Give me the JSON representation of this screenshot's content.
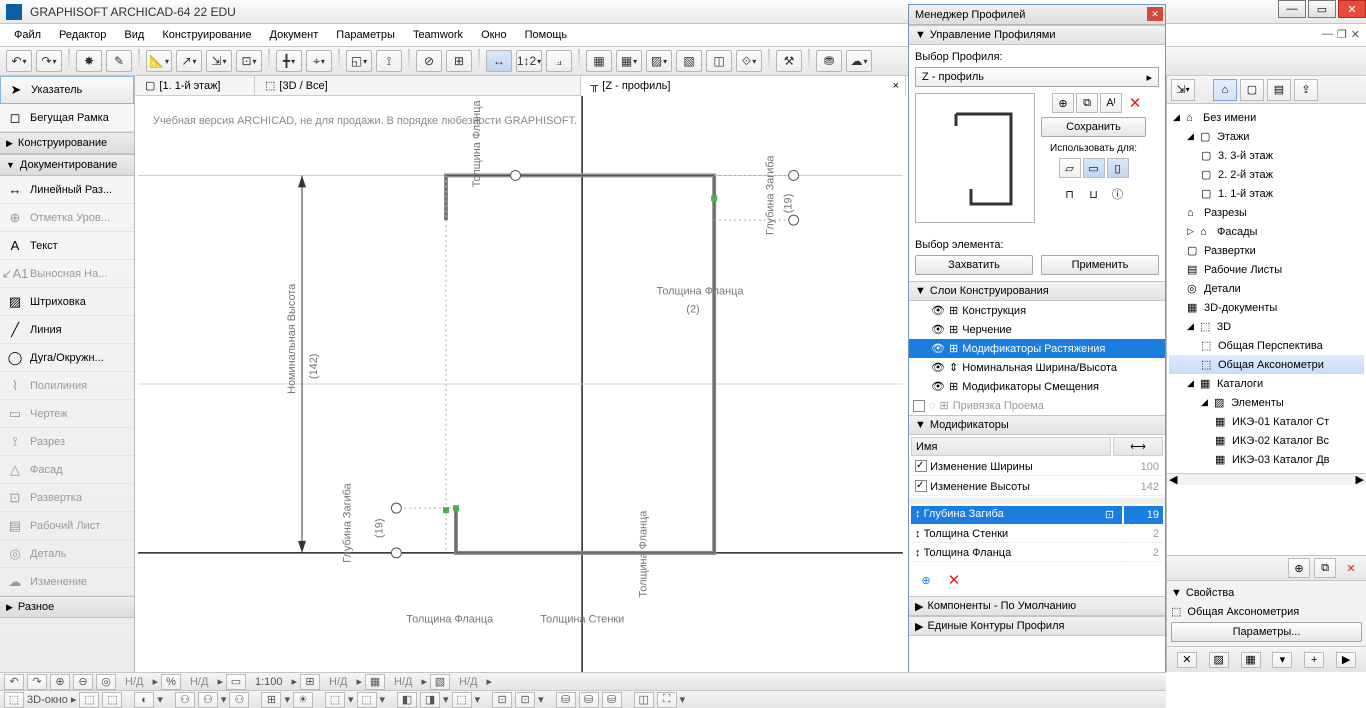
{
  "app": {
    "title": "GRAPHISOFT ARCHICAD-64 22 EDU"
  },
  "menus": [
    "Файл",
    "Редактор",
    "Вид",
    "Конструирование",
    "Документ",
    "Параметры",
    "Teamwork",
    "Окно",
    "Помощь"
  ],
  "view_tabs": [
    {
      "label": "[1. 1-й этаж]"
    },
    {
      "label": "[3D / Все]"
    },
    {
      "label": "[Z - профиль]"
    }
  ],
  "watermark": "Учебная версия ARCHICAD, не для продажи. В порядке любезности GRAPHISOFT.",
  "toolbox": {
    "pointer": "Указатель",
    "marquee": "Бегущая Рамка",
    "group_construct": "Конструирование",
    "group_document": "Документирование",
    "linear_dim": "Линейный Раз...",
    "level_dim": "Отметка Уров...",
    "text": "Текст",
    "label": "Выносная На...",
    "fill": "Штриховка",
    "line": "Линия",
    "arc": "Дуга/Окружн...",
    "polyline": "Полилиния",
    "drawing": "Чертеж",
    "section": "Разрез",
    "elevation": "Фасад",
    "worksheet": "Развертка",
    "layout": "Рабочий Лист",
    "detail": "Деталь",
    "change": "Изменение",
    "group_misc": "Разное"
  },
  "canvas": {
    "labels": {
      "nom_height": "Номинальная Высота",
      "nom_height_val": "(142)",
      "flange_thk_top": "Толщина Фланца",
      "flange_thk_side": "Толщина Фланца",
      "flange_thk_val": "(2)",
      "bend_depth_l": "Глубина Загиба",
      "bend_depth_l_val": "(19)",
      "bend_depth_r": "Глубина Загиба",
      "bend_depth_r_val": "(19)",
      "wall_thk": "Толщина Стенки",
      "flange_thk_bottom": "Толщина Фланца",
      "flange_thk_right": "Толщина Фланца"
    }
  },
  "status": {
    "scale": "1:100",
    "nd": "Н/Д",
    "window3d": "3D-окно"
  },
  "profile_mgr": {
    "title": "Менеджер Профилей",
    "section_manage": "Управление Профилями",
    "choose_profile": "Выбор Профиля:",
    "profile_value": "Z - профиль",
    "save": "Сохранить",
    "use_for": "Использовать для:",
    "choose_elem": "Выбор элемента:",
    "capture": "Захватить",
    "apply": "Применить",
    "section_layers": "Слои Конструирования",
    "layers": [
      "Конструкция",
      "Черчение",
      "Модификаторы Растяжения",
      "Номинальная Ширина/Высота",
      "Модификаторы Смещения",
      "Привязка Проема"
    ],
    "section_mods": "Модификаторы",
    "mod_header_name": "Имя",
    "mods": [
      {
        "name": "Изменение Ширины",
        "val": "100",
        "checked": true
      },
      {
        "name": "Изменение Высоты",
        "val": "142",
        "checked": true
      }
    ],
    "params": [
      {
        "name": "Глубина Загиба",
        "val": "19",
        "sel": true
      },
      {
        "name": "Толщина Стенки",
        "val": "2"
      },
      {
        "name": "Толщина Фланца",
        "val": "2"
      }
    ],
    "section_components": "Компоненты - По Умолчанию",
    "section_contours": "Единые Контуры Профиля"
  },
  "nav": {
    "root": "Без имени",
    "floors": "Этажи",
    "floor3": "3. 3-й этаж",
    "floor2": "2. 2-й этаж",
    "floor1": "1. 1-й этаж",
    "sections": "Разрезы",
    "elevations": "Фасады",
    "interior": "Развертки",
    "worksheets": "Рабочие Листы",
    "details": "Детали",
    "docs3d": "3D-документы",
    "three_d": "3D",
    "persp": "Общая Перспектива",
    "axo": "Общая Аксонометри",
    "catalogs": "Каталоги",
    "elements": "Элементы",
    "cat1": "ИКЭ-01 Каталог Ст",
    "cat2": "ИКЭ-02 Каталог Вс",
    "cat3": "ИКЭ-03 Каталог Дв",
    "props": "Свойства",
    "axo_full": "Общая Аксонометрия",
    "params_btn": "Параметры..."
  }
}
